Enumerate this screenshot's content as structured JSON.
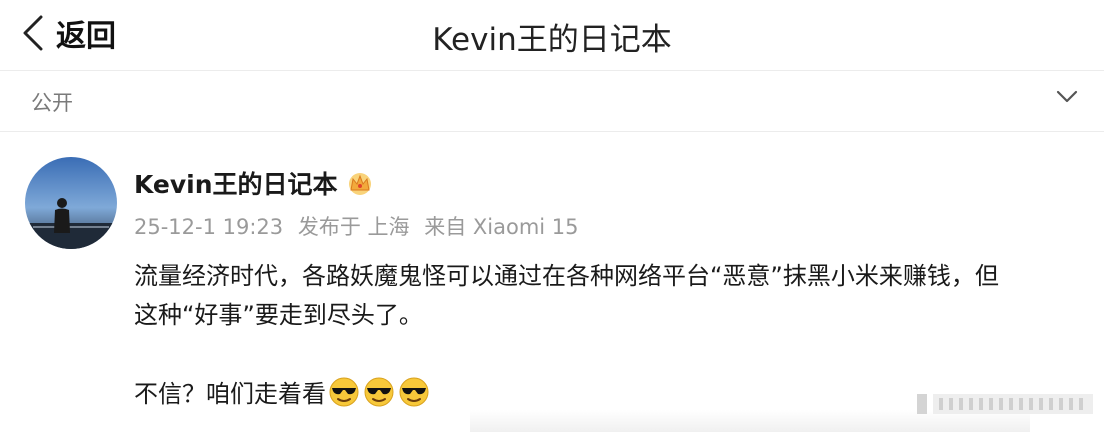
{
  "nav": {
    "back_label": "返回",
    "title": "Kevin王的日记本"
  },
  "visibility": {
    "label": "公开"
  },
  "post": {
    "username": "Kevin王的日记本",
    "meta": {
      "date": "25-12-1 19:23",
      "location": "发布于 上海",
      "device": "来自 Xiaomi 15"
    },
    "content": {
      "line1": "流量经济时代，各路妖魔鬼怪可以通过在各种网络平台“恶意”抹黑小米来赚钱，但",
      "line2": "这种“好事”要走到尽头了。",
      "line3": "不信？咱们走着看"
    }
  },
  "icons": {
    "back": "chevron-left-icon",
    "expand": "chevron-down-icon",
    "badge": "crown-icon",
    "emoji": "sunglasses-emoji"
  },
  "colors": {
    "text": "#1a1a1a",
    "meta": "#9a9a9a",
    "divider": "#ececec",
    "crown": "#f2a93b"
  }
}
